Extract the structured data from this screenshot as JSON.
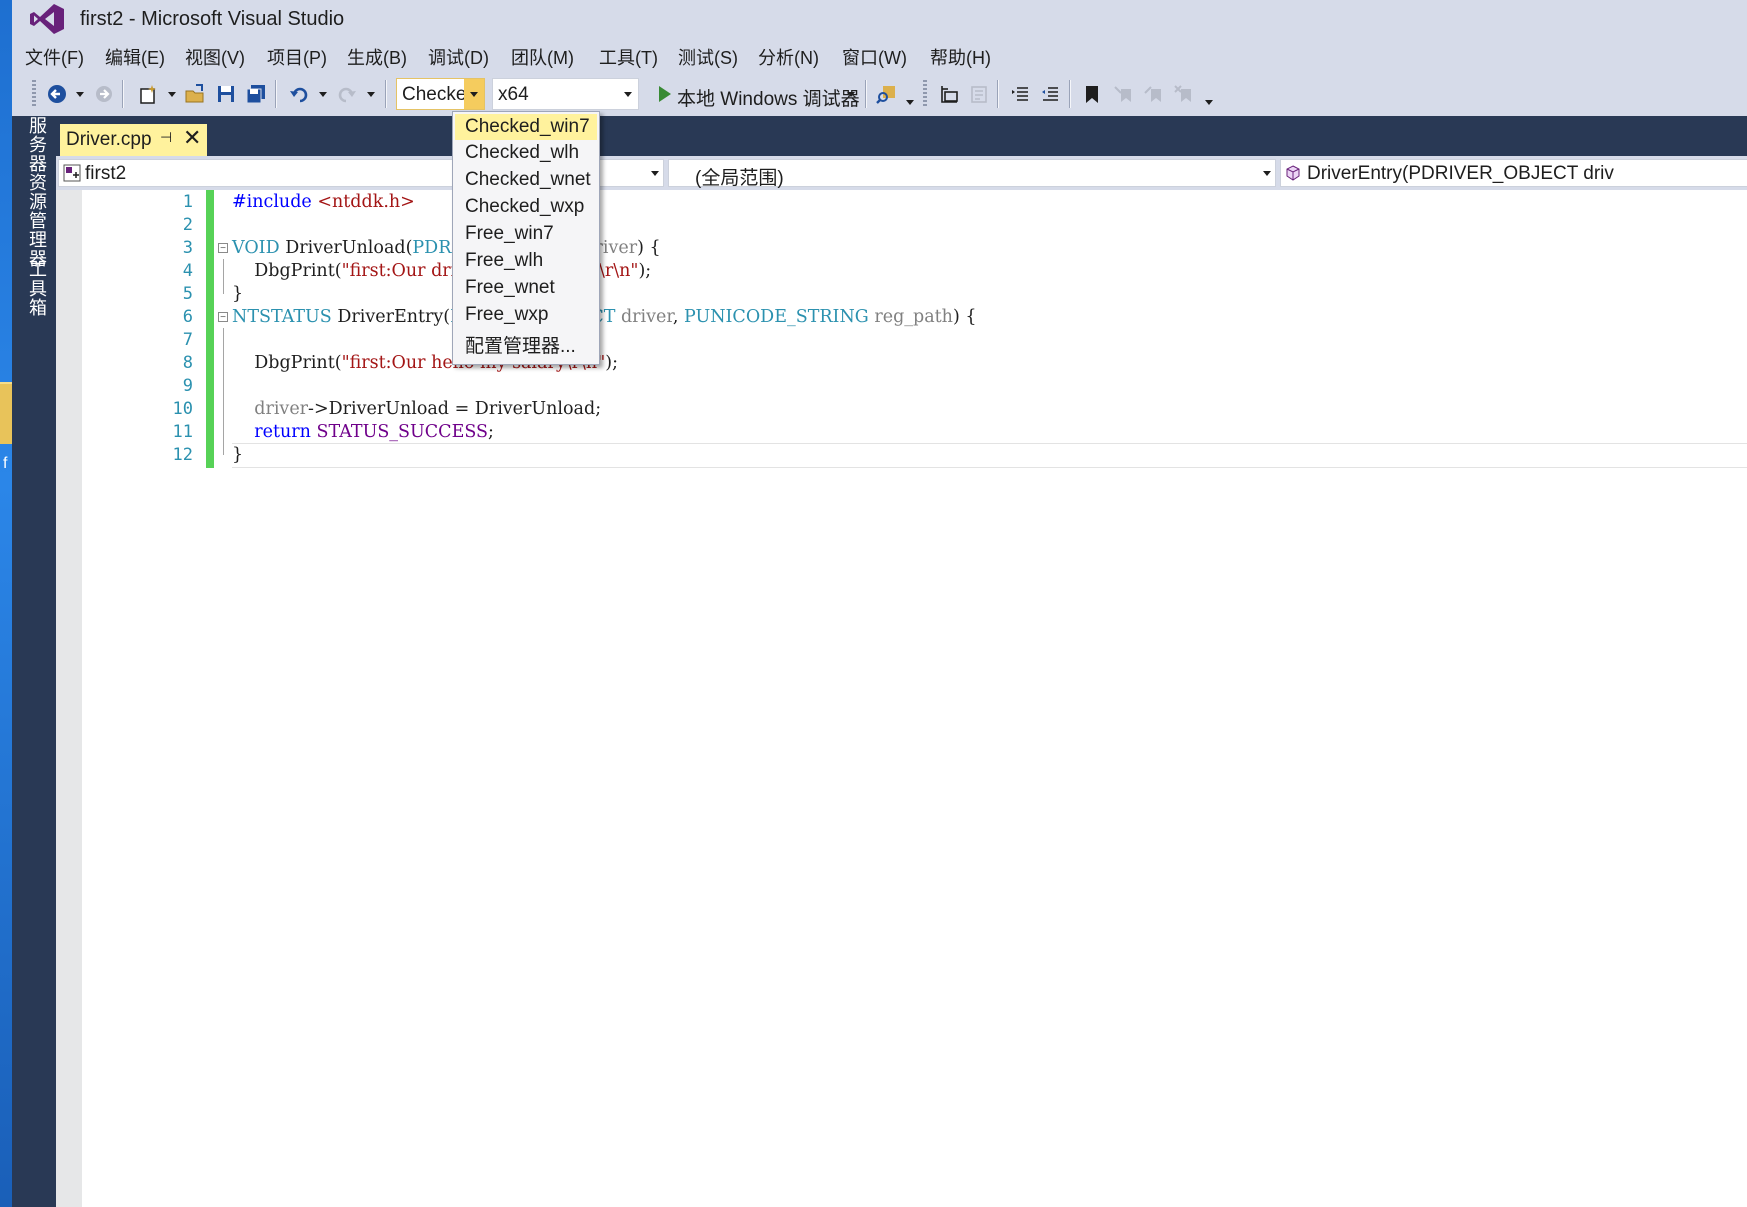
{
  "window": {
    "title": "first2 - Microsoft Visual Studio"
  },
  "menu": [
    "文件(F)",
    "编辑(E)",
    "视图(V)",
    "项目(P)",
    "生成(B)",
    "调试(D)",
    "团队(M)",
    "工具(T)",
    "测试(S)",
    "分析(N)",
    "窗口(W)",
    "帮助(H)"
  ],
  "toolbar": {
    "config_value": "Checked",
    "platform_value": "x64",
    "debugger_label": "本地 Windows 调试器"
  },
  "sidebar": {
    "server_explorer": "服务器资源管理器",
    "toolbox": "工具箱"
  },
  "tab": {
    "name": "Driver.cpp",
    "pin": "⊣",
    "close": "✕"
  },
  "navbar": {
    "project": "first2",
    "scope": "(全局范围)",
    "member": "DriverEntry(PDRIVER_OBJECT driv"
  },
  "dropdown": {
    "items": [
      "Checked_win7",
      "Checked_wlh",
      "Checked_wnet",
      "Checked_wxp",
      "Free_win7",
      "Free_wlh",
      "Free_wnet",
      "Free_wxp",
      "配置管理器..."
    ],
    "selected_index": 0
  },
  "editor": {
    "line_numbers": [
      "1",
      "2",
      "3",
      "4",
      "5",
      "6",
      "7",
      "8",
      "9",
      "10",
      "11",
      "12"
    ]
  },
  "desktop": {
    "text": "f"
  },
  "colors": {
    "accent": "#68217a",
    "frame": "#293955",
    "chrome": "#d6dbe9",
    "highlight": "#fff29d",
    "change": "#57d257"
  }
}
